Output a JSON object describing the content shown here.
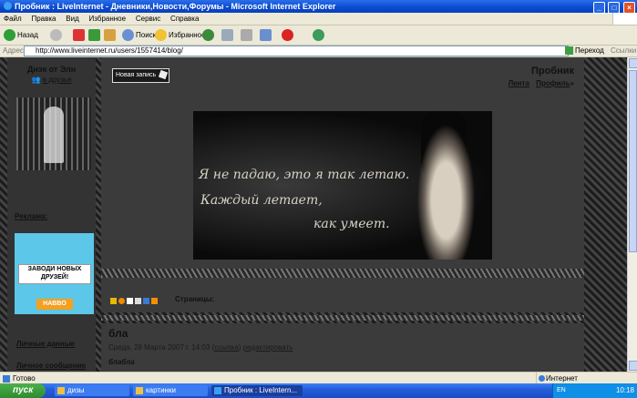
{
  "window": {
    "title": "Пробник : LiveInternet - Дневники,Новости,Форумы - Microsoft Internet Explorer",
    "min": "_",
    "max": "□",
    "close": "×"
  },
  "menu": [
    "Файл",
    "Правка",
    "Вид",
    "Избранное",
    "Сервис",
    "Справка"
  ],
  "toolbar": {
    "back": "Назад",
    "search": "Поиск",
    "favorites": "Избранное"
  },
  "address": {
    "label": "Адрес:",
    "url": "http://www.liveinternet.ru/users/1557414/blog/",
    "go": "Переход",
    "links": "Ссылки"
  },
  "sidebar": {
    "owner": "Днэк от Элн",
    "friends": "в друзья",
    "ads_title": "Реклама:",
    "ad_text": "ЗАВОДИ НОВЫХ ДРУЗЕЙ!",
    "ad_brand": "HABBO",
    "links": [
      "Личные данные",
      "Личное сообщение"
    ]
  },
  "blog": {
    "new_post": "Новая запись",
    "title": "Пробник",
    "nav": [
      "Лента",
      "Профиль"
    ],
    "nav_arrow": "»",
    "quote": [
      "Я не падаю, это я так летаю.",
      "Каждый летает,",
      "как умеет."
    ],
    "pages_label": "Страницы:"
  },
  "post": {
    "title": "бла",
    "date": "Среда, 28 Марта 2007 г. 14:03",
    "links": [
      "ссылка",
      "редактировать"
    ],
    "body": "блабла"
  },
  "statusbar": {
    "status": "Готово",
    "zone": "Интернет"
  },
  "taskbar": {
    "start": "пуск",
    "tasks": [
      "дизы",
      "картинки",
      "Пробник : LiveIntern..."
    ],
    "lang": "EN",
    "clock": "10:18"
  }
}
